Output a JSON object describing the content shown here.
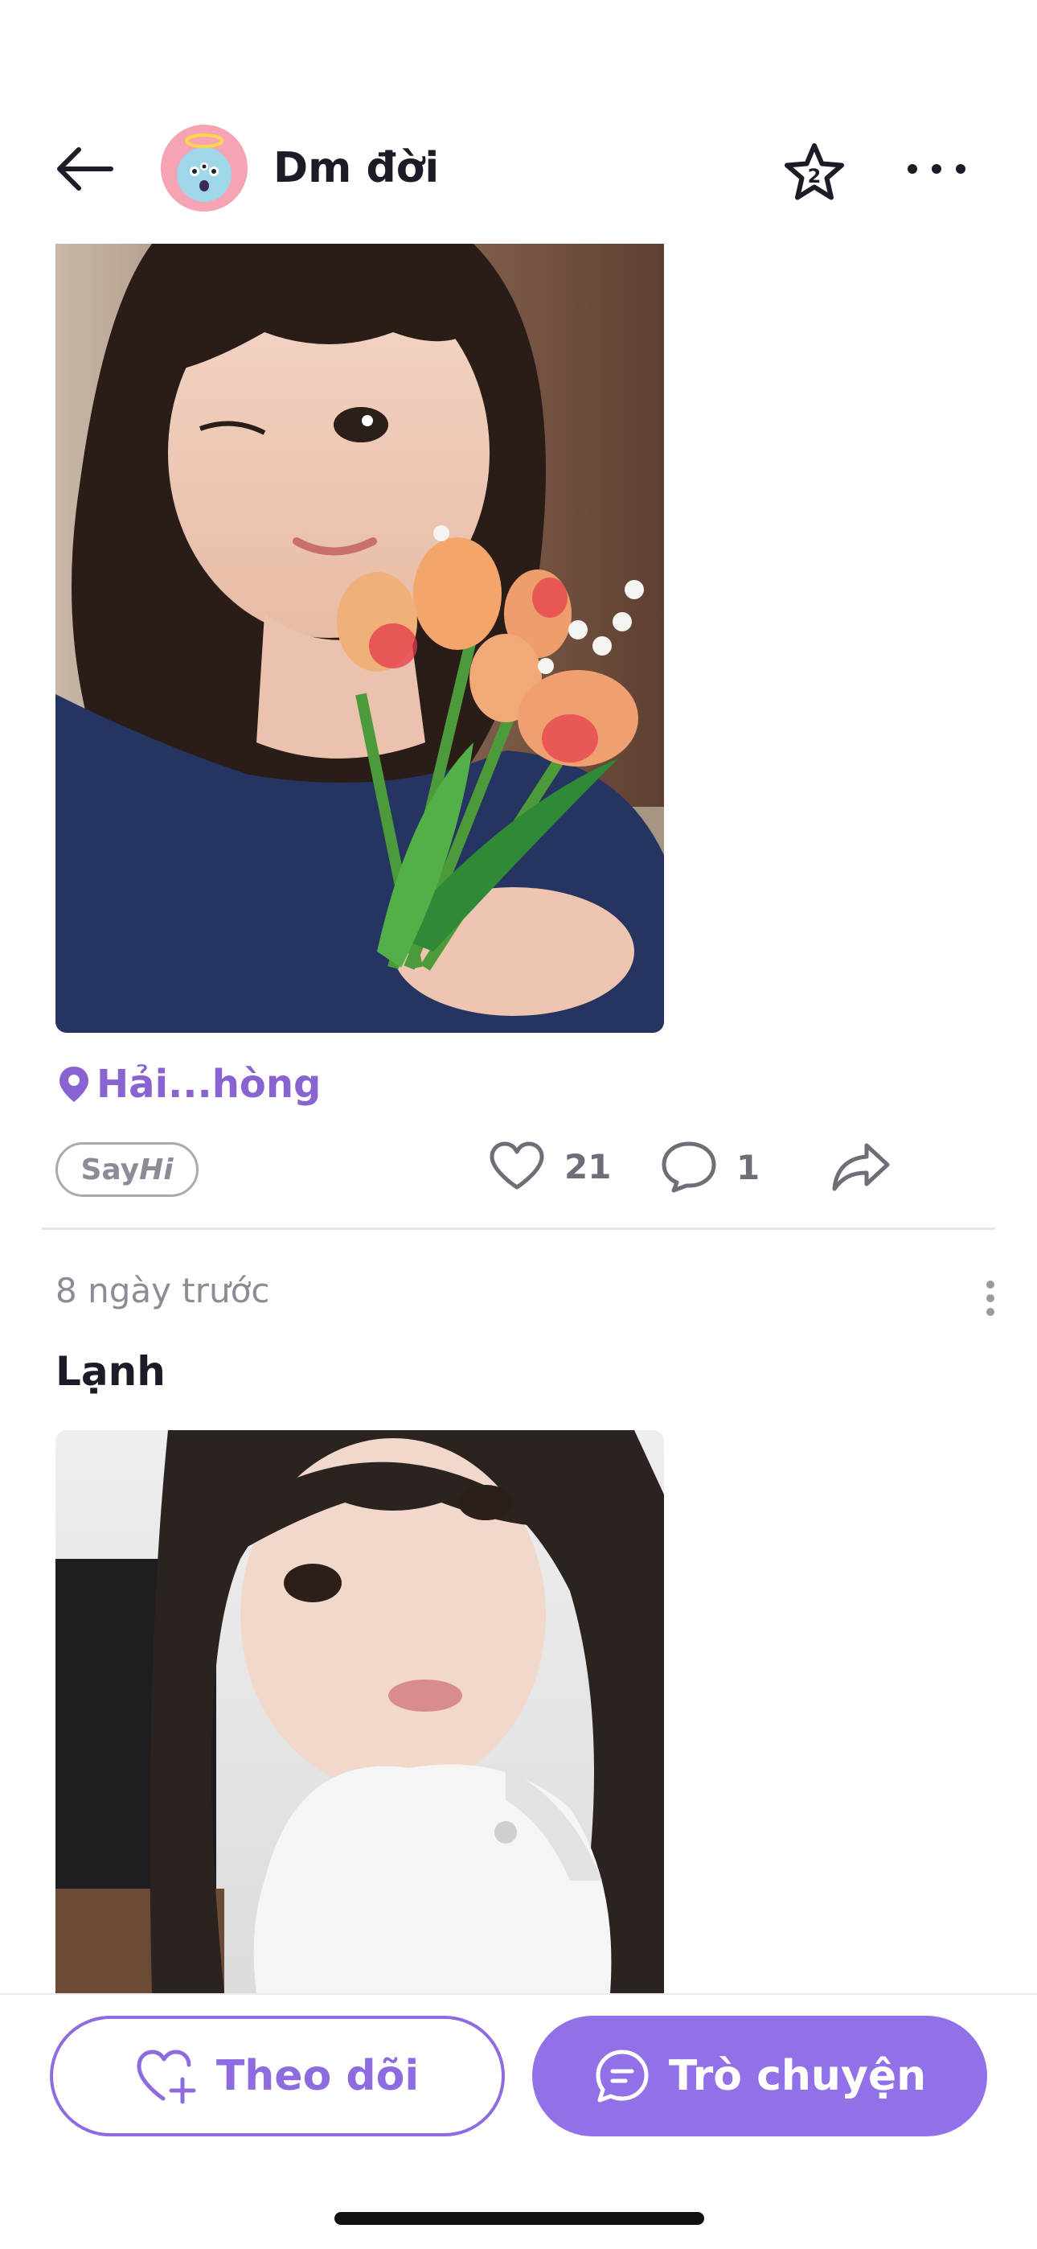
{
  "header": {
    "title": "Dm đời",
    "star_badge": "2"
  },
  "post1": {
    "location": "Hải...hòng",
    "sayhi_say": "Say",
    "sayhi_hi": "Hi",
    "likes": "21",
    "comments": "1"
  },
  "post2": {
    "time": "8 ngày trước",
    "title": "Lạnh"
  },
  "bottom": {
    "follow_label": "Theo dõi",
    "chat_label": "Trò chuyện"
  },
  "colors": {
    "accent": "#9270e8",
    "location": "#8a63d2"
  }
}
